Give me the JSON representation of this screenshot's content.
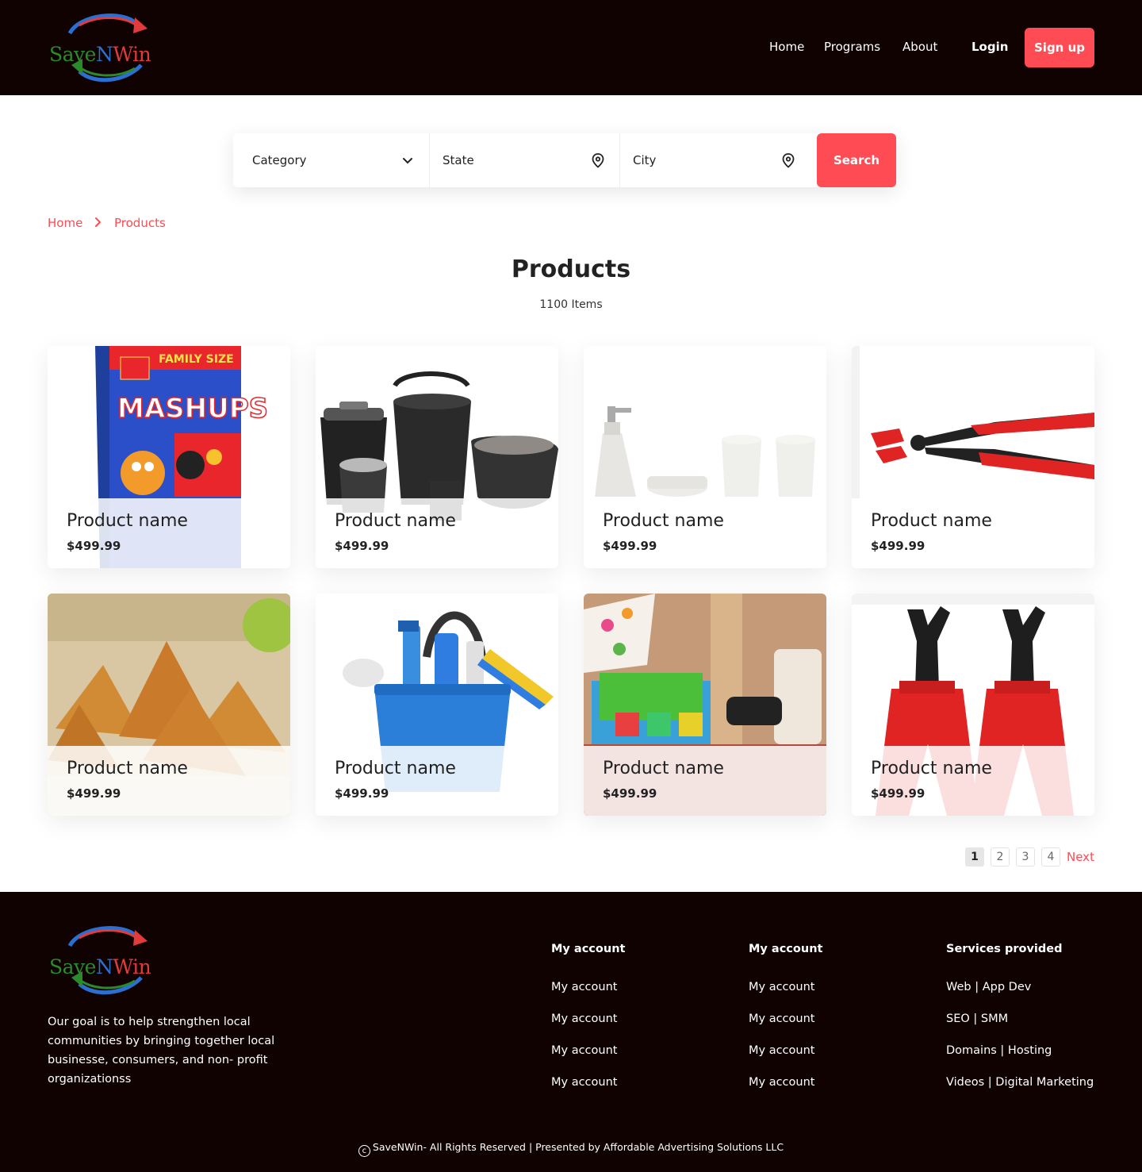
{
  "brand": {
    "part1": "Save",
    "part2": "N",
    "part3": "Win"
  },
  "nav": {
    "home": "Home",
    "programs": "Programs",
    "about": "About",
    "login": "Login",
    "signup": "Sign up"
  },
  "search": {
    "category": "Category",
    "state": "State",
    "city": "City",
    "button": "Search"
  },
  "breadcrumb": {
    "home": "Home",
    "current": "Products"
  },
  "page": {
    "title": "Products",
    "count": "1100 Items"
  },
  "products": [
    {
      "name": "Product name",
      "price": "$499.99",
      "image": "cereal-box"
    },
    {
      "name": "Product name",
      "price": "$499.99",
      "image": "plastic-buckets"
    },
    {
      "name": "Product name",
      "price": "$499.99",
      "image": "bathroom-set"
    },
    {
      "name": "Product name",
      "price": "$499.99",
      "image": "pliers"
    },
    {
      "name": "Product name",
      "price": "$499.99",
      "image": "samosas"
    },
    {
      "name": "Product name",
      "price": "$499.99",
      "image": "cleaning-bucket"
    },
    {
      "name": "Product name",
      "price": "$499.99",
      "image": "kitchen-items"
    },
    {
      "name": "Product name",
      "price": "$499.99",
      "image": "jack-stands"
    }
  ],
  "pagination": {
    "pages": [
      "1",
      "2",
      "3",
      "4"
    ],
    "active": "1",
    "next": "Next"
  },
  "footer": {
    "about": "Our goal is to help strengthen local communities by bringing together local businesse, consumers, and non- profit organizationss",
    "col1": {
      "title": "My account",
      "links": [
        "My account",
        "My account",
        "My account",
        "My account"
      ]
    },
    "col2": {
      "title": "My account",
      "links": [
        "My account",
        "My account",
        "My account",
        "My account"
      ]
    },
    "col3": {
      "title": "Services provided",
      "links": [
        "Web | App Dev",
        "SEO | SMM",
        "Domains | Hosting",
        "Videos | Digital Marketing"
      ]
    },
    "copyright": "SaveNWin- All Rights Reserved | Presented by Affordable Advertising Solutions LLC"
  },
  "colors": {
    "accent": "#ff4b53",
    "dark": "#110202"
  }
}
